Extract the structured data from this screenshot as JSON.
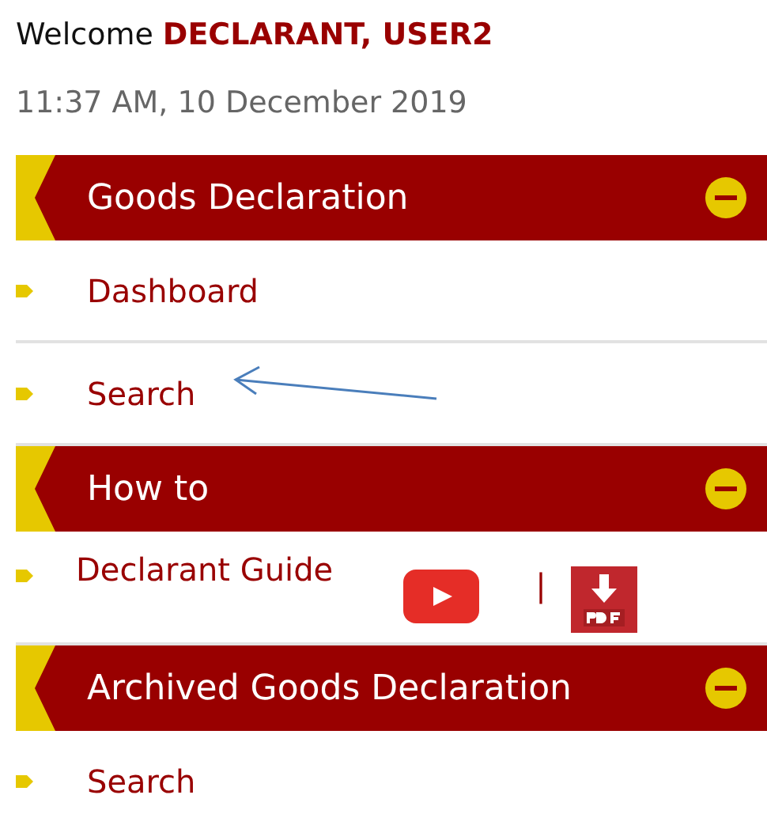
{
  "welcome": {
    "greeting": "Welcome",
    "user_name": "DECLARANT, USER2"
  },
  "datetime": "11:37 AM, 10 December 2019",
  "sections": [
    {
      "title": "Goods Declaration",
      "expanded": true,
      "items": [
        {
          "kind": "link",
          "label": "Dashboard"
        },
        {
          "kind": "link",
          "label": "Search"
        }
      ]
    },
    {
      "title": "How to",
      "expanded": true,
      "items": [
        {
          "kind": "guide",
          "label": "Declarant Guide",
          "separator": "|"
        }
      ]
    },
    {
      "title": "Archived Goods Declaration",
      "expanded": true,
      "items": [
        {
          "kind": "link",
          "label": "Search"
        }
      ]
    }
  ]
}
